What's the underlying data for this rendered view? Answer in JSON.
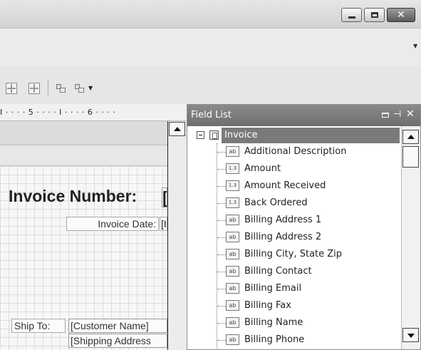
{
  "window": {
    "controls": {
      "minimize_icon": "minimize-icon",
      "maximize_icon": "maximize-icon",
      "close_icon": "close-icon",
      "close_glyph": "✕"
    }
  },
  "ruler": {
    "text": "I · · · · 5 · · · · I · · · · 6 · · · ·"
  },
  "document": {
    "invoice_number_label": "Invoice Number:",
    "invoice_number_field": "[I",
    "invoice_date_label": "Invoice Date:",
    "invoice_date_field": "[I",
    "ship_to_label": "Ship To:",
    "ship_customer_name": "[Customer Name]",
    "ship_address": "[Shipping Address"
  },
  "field_list": {
    "title": "Field List",
    "pin_glyph": "⊣",
    "close_glyph": "✕",
    "root": "Invoice",
    "items": [
      {
        "label": "Additional Description",
        "type": "ab"
      },
      {
        "label": "Amount",
        "type": "1.3"
      },
      {
        "label": "Amount Received",
        "type": "1.3"
      },
      {
        "label": "Back Ordered",
        "type": "1.3"
      },
      {
        "label": "Billing Address 1",
        "type": "ab"
      },
      {
        "label": "Billing Address 2",
        "type": "ab"
      },
      {
        "label": "Billing City, State Zip",
        "type": "ab"
      },
      {
        "label": "Billing Contact",
        "type": "ab"
      },
      {
        "label": "Billing Email",
        "type": "ab"
      },
      {
        "label": "Billing Fax",
        "type": "ab"
      },
      {
        "label": "Billing Name",
        "type": "ab"
      },
      {
        "label": "Billing Phone",
        "type": "ab"
      }
    ]
  },
  "colors": {
    "selected_row": "#7a7a7a",
    "panel_header": "#7c7c7c"
  }
}
